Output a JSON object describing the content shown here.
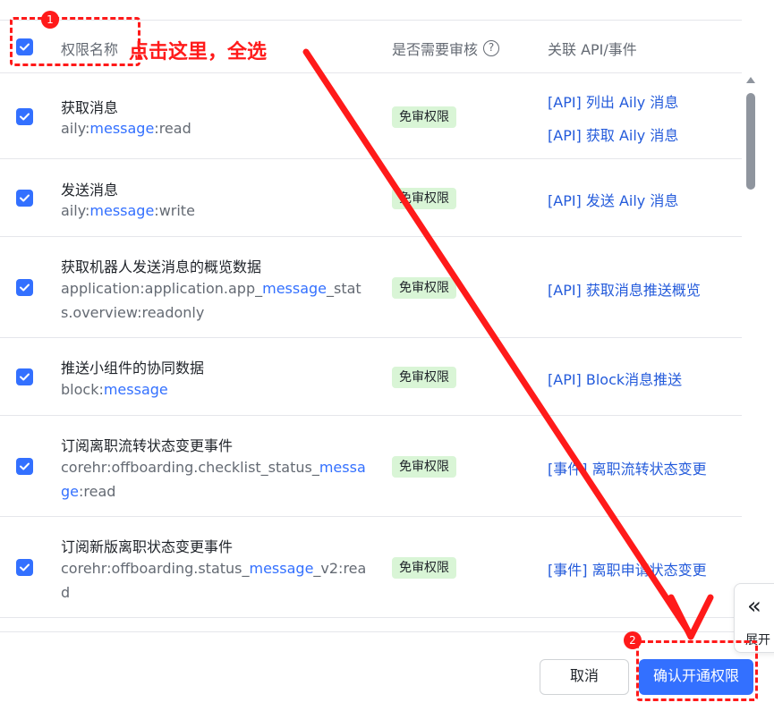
{
  "table": {
    "headers": {
      "name": "权限名称",
      "review": "是否需要审核",
      "help_glyph": "?",
      "api": "关联 API/事件"
    },
    "rows": [
      {
        "title": "获取消息",
        "scope_parts": [
          "aily:",
          "message",
          ":read"
        ],
        "badge": "免审权限",
        "apis": [
          "[API] 列出 Aily 消息",
          "[API] 获取 Aily 消息"
        ]
      },
      {
        "title": "发送消息",
        "scope_parts": [
          "aily:",
          "message",
          ":write"
        ],
        "badge": "免审权限",
        "apis": [
          "[API] 发送 Aily 消息"
        ]
      },
      {
        "title": "获取机器人发送消息的概览数据",
        "scope_parts": [
          "application:application.app_",
          "message",
          "_stats.overview:readonly"
        ],
        "badge": "免审权限",
        "apis": [
          "[API] 获取消息推送概览"
        ]
      },
      {
        "title": "推送小组件的协同数据",
        "scope_parts": [
          "block:",
          "message",
          ""
        ],
        "badge": "免审权限",
        "apis": [
          "[API] Block消息推送"
        ]
      },
      {
        "title": "订阅离职流转状态变更事件",
        "scope_parts": [
          "corehr:offboarding.checklist_status_",
          "message",
          ":read"
        ],
        "badge": "免审权限",
        "apis": [
          "[事件] 离职流转状态变更"
        ]
      },
      {
        "title": "订阅新版离职状态变更事件",
        "scope_parts": [
          "corehr:offboarding.status_",
          "message",
          "_v2:read"
        ],
        "badge": "免审权限",
        "apis": [
          "[事件] 离职申请状态变更"
        ]
      }
    ]
  },
  "footer": {
    "cancel_label": "取消",
    "confirm_label": "确认开通权限"
  },
  "expand_panel": {
    "chevron_glyph": "«",
    "label": "展开"
  },
  "annotations": {
    "step1_number": "1",
    "step1_text": "点击这里，全选",
    "step2_number": "2",
    "color": "#ff1a1a"
  },
  "colors": {
    "primary": "#3370ff",
    "link": "#245bdb",
    "badge_bg": "#d9f5d6"
  }
}
